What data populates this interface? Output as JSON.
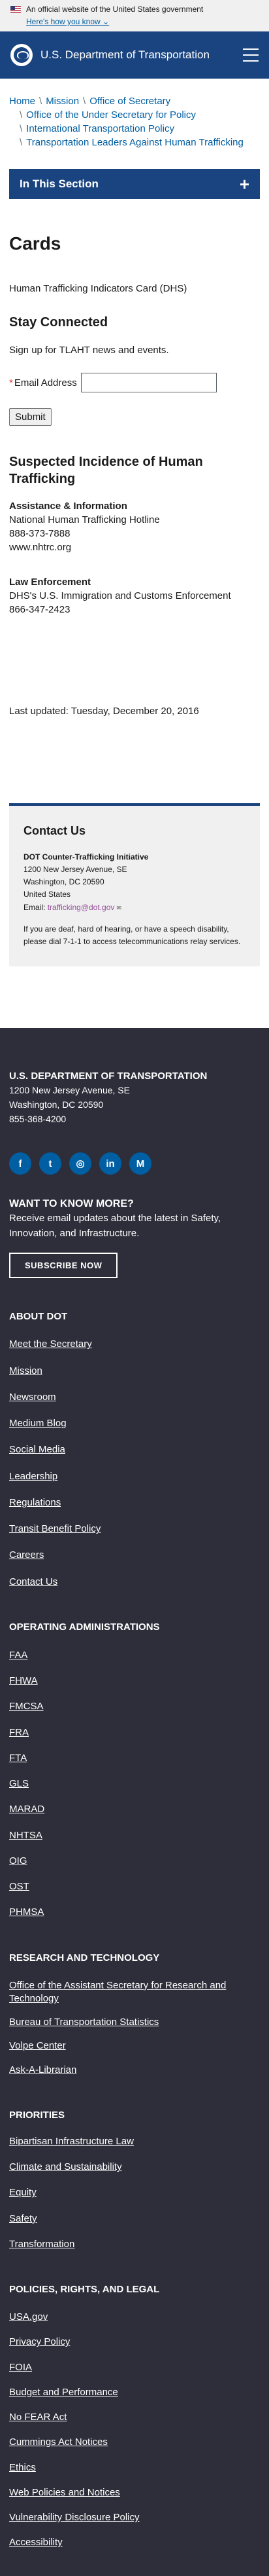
{
  "gov_banner": {
    "official_text": "An official website of the United States government",
    "how_text": "Here's how you know"
  },
  "header": {
    "site_name": "U.S. Department of Transportation"
  },
  "breadcrumbs": [
    "Home",
    "Mission",
    "Office of Secretary",
    "Office of the Under Secretary for Policy",
    "International Transportation Policy",
    "Transportation Leaders Against Human Trafficking"
  ],
  "section_nav": {
    "label": "In This Section",
    "toggle": "+"
  },
  "page": {
    "title": "Cards",
    "document": "Human Trafficking Indicators Card (DHS)",
    "stay_heading": "Stay Connected",
    "signup_text": "Sign up for TLAHT news and events.",
    "email_label": "Email Address",
    "submit_label": "Submit",
    "suspected_heading": "Suspected Incidence of Human Trafficking",
    "assistance": {
      "heading": "Assistance & Information",
      "lines": [
        "National Human Trafficking Hotline",
        "888-373-7888",
        "www.nhtrc.org"
      ]
    },
    "law": {
      "heading": "Law Enforcement",
      "lines": [
        "DHS's U.S. Immigration and Customs Enforcement",
        "866-347-2423"
      ]
    },
    "updated": "Last updated: Tuesday, December 20, 2016"
  },
  "contact": {
    "heading": "Contact Us",
    "org": "DOT Counter-Trafficking Initiative",
    "address": [
      "1200 New Jersey Avenue, SE",
      "Washington, DC 20590",
      "United States"
    ],
    "email_label": "Email:",
    "email": "trafficking@dot.gov",
    "note": "If you are deaf, hard of hearing, or have a speech disability, please dial 7-1-1 to access telecommunications relay services."
  },
  "footer": {
    "dept": "U.S. DEPARTMENT OF TRANSPORTATION",
    "address": [
      "1200 New Jersey Avenue, SE",
      "Washington, DC 20590"
    ],
    "phone": "855-368-4200",
    "social": [
      {
        "name": "facebook-icon",
        "glyph": "f"
      },
      {
        "name": "twitter-icon",
        "glyph": "t"
      },
      {
        "name": "instagram-icon",
        "glyph": "◎"
      },
      {
        "name": "linkedin-icon",
        "glyph": "in"
      },
      {
        "name": "medium-icon",
        "glyph": "M"
      }
    ],
    "want_heading": "WANT TO KNOW MORE?",
    "want_text": "Receive email updates about the latest in Safety, Innovation, and Infrastructure.",
    "subscribe": "SUBSCRIBE NOW",
    "about": {
      "heading": "ABOUT DOT",
      "links": [
        "Meet the Secretary",
        "Mission",
        "Newsroom",
        "Medium Blog",
        "Social Media",
        "Leadership",
        "Regulations",
        "Transit Benefit Policy",
        "Careers",
        "Contact Us"
      ]
    },
    "ops": {
      "heading": "OPERATING ADMINISTRATIONS",
      "links": [
        "FAA",
        "FHWA",
        "FMCSA",
        "FRA",
        "FTA",
        "GLS",
        "MARAD",
        "NHTSA",
        "OIG",
        "OST",
        "PHMSA"
      ]
    },
    "research": {
      "heading": "RESEARCH AND TECHNOLOGY",
      "links": [
        "Office of the Assistant Secretary for Research and Technology",
        "Bureau of Transportation Statistics",
        "Volpe Center",
        "Ask-A-Librarian"
      ]
    },
    "priorities": {
      "heading": "PRIORITIES",
      "links": [
        "Bipartisan Infrastructure Law",
        "Climate and Sustainability",
        "Equity",
        "Safety",
        "Transformation"
      ]
    },
    "policies": {
      "heading": "POLICIES, RIGHTS, AND LEGAL",
      "links": [
        "USA.gov",
        "Privacy Policy",
        "FOIA",
        "Budget and Performance",
        "No FEAR Act",
        "Cummings Act Notices",
        "Ethics",
        "Web Policies and Notices",
        "Vulnerability Disclosure Policy",
        "Accessibility"
      ]
    }
  },
  "colors": {
    "header_bg": "#1a4480",
    "footer_bg": "#2d2e3a",
    "link": "#005ea2",
    "social_bg": "#005ea2"
  }
}
